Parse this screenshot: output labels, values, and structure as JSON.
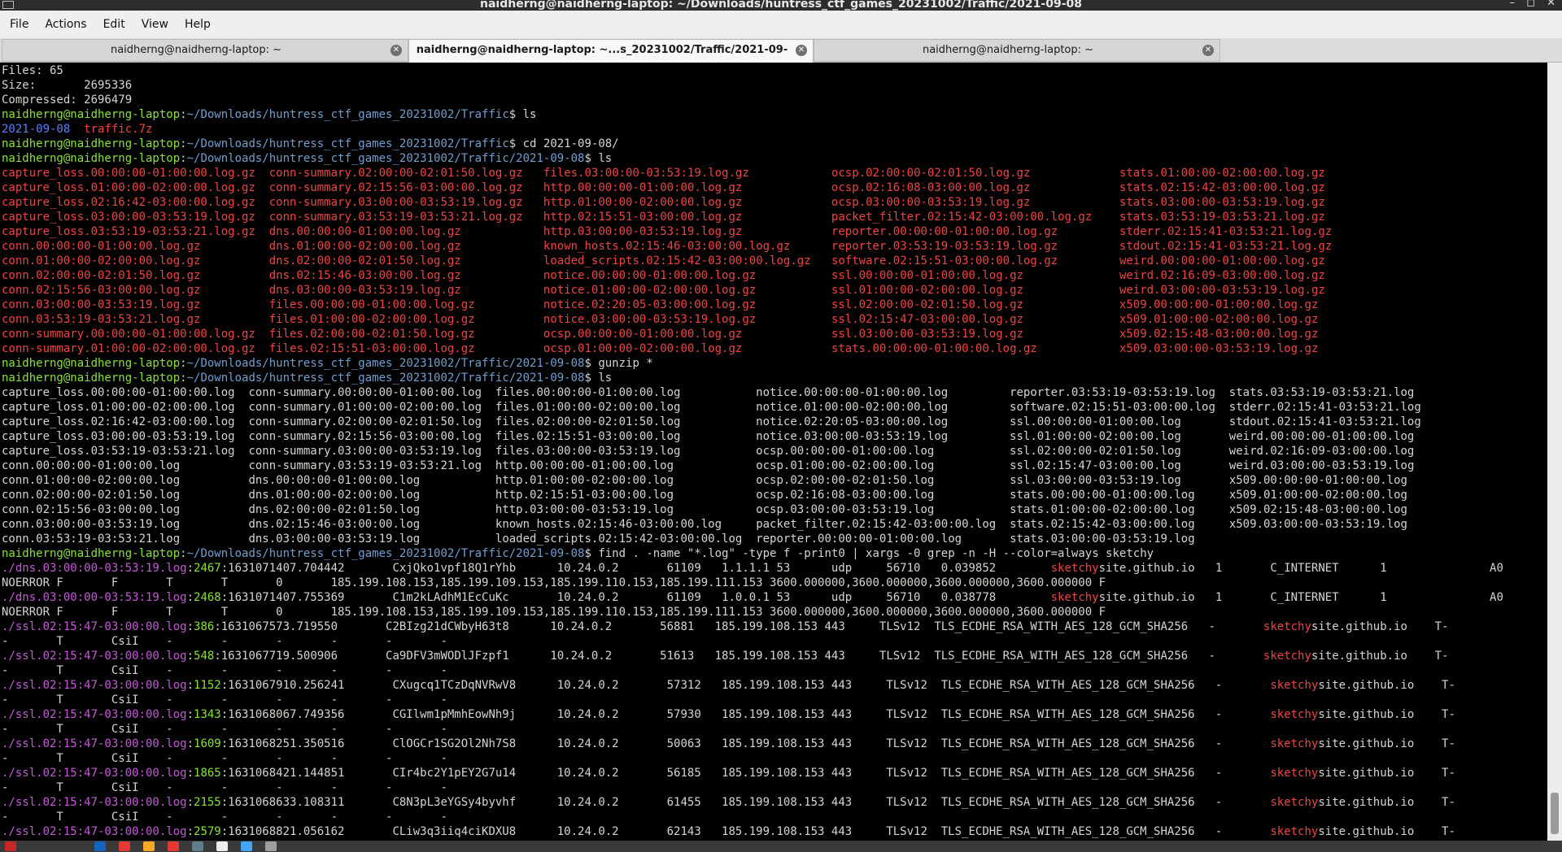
{
  "window": {
    "title": "naidherng@naidherng-laptop: ~/Downloads/huntress_ctf_games_20231002/Traffic/2021-09-08",
    "controls": [
      "minimize",
      "maximize",
      "close"
    ]
  },
  "menubar": {
    "items": [
      "File",
      "Actions",
      "Edit",
      "View",
      "Help"
    ]
  },
  "tabs": [
    {
      "label": "naidherng@naidherng-laptop: ~",
      "active": false
    },
    {
      "label": "naidherng@naidherng-laptop: ~...s_20231002/Traffic/2021-09-08",
      "active": true
    },
    {
      "label": "naidherng@naidherng-laptop: ~",
      "active": false
    }
  ],
  "prompt": {
    "user": "naidherng@naidherng-laptop",
    "path_traffic": "~/Downloads/huntress_ctf_games_20231002/Traffic",
    "path_day": "~/Downloads/huntress_ctf_games_20231002/Traffic/2021-09-08"
  },
  "terminal": {
    "archive_stats": [
      "Files: 65",
      "Size:       2695336",
      "Compressed: 2696479"
    ],
    "commands": [
      "ls",
      "cd 2021-09-08/",
      "ls",
      "gunzip *",
      "ls",
      "find . -name \"*.log\" -type f -print0 | xargs -0 grep -n -H --color=always sketchy"
    ],
    "ls_traffic": [
      {
        "text": "2021-09-08",
        "kind": "dir"
      },
      {
        "text": "traffic.7z",
        "kind": "archive"
      }
    ],
    "gz_listing": [
      [
        "capture_loss.00:00:00-01:00:00.log.gz",
        "conn-summary.02:00:00-02:01:50.log.gz",
        "files.03:00:00-03:53:19.log.gz",
        "ocsp.02:00:00-02:01:50.log.gz",
        "stats.01:00:00-02:00:00.log.gz"
      ],
      [
        "capture_loss.01:00:00-02:00:00.log.gz",
        "conn-summary.02:15:56-03:00:00.log.gz",
        "http.00:00:00-01:00:00.log.gz",
        "ocsp.02:16:08-03:00:00.log.gz",
        "stats.02:15:42-03:00:00.log.gz"
      ],
      [
        "capture_loss.02:16:42-03:00:00.log.gz",
        "conn-summary.03:00:00-03:53:19.log.gz",
        "http.01:00:00-02:00:00.log.gz",
        "ocsp.03:00:00-03:53:19.log.gz",
        "stats.03:00:00-03:53:19.log.gz"
      ],
      [
        "capture_loss.03:00:00-03:53:19.log.gz",
        "conn-summary.03:53:19-03:53:21.log.gz",
        "http.02:15:51-03:00:00.log.gz",
        "packet_filter.02:15:42-03:00:00.log.gz",
        "stats.03:53:19-03:53:21.log.gz"
      ],
      [
        "capture_loss.03:53:19-03:53:21.log.gz",
        "dns.00:00:00-01:00:00.log.gz",
        "http.03:00:00-03:53:19.log.gz",
        "reporter.00:00:00-01:00:00.log.gz",
        "stderr.02:15:41-03:53:21.log.gz"
      ],
      [
        "conn.00:00:00-01:00:00.log.gz",
        "dns.01:00:00-02:00:00.log.gz",
        "known_hosts.02:15:46-03:00:00.log.gz",
        "reporter.03:53:19-03:53:19.log.gz",
        "stdout.02:15:41-03:53:21.log.gz"
      ],
      [
        "conn.01:00:00-02:00:00.log.gz",
        "dns.02:00:00-02:01:50.log.gz",
        "loaded_scripts.02:15:42-03:00:00.log.gz",
        "software.02:15:51-03:00:00.log.gz",
        "weird.00:00:00-01:00:00.log.gz"
      ],
      [
        "conn.02:00:00-02:01:50.log.gz",
        "dns.02:15:46-03:00:00.log.gz",
        "notice.00:00:00-01:00:00.log.gz",
        "ssl.00:00:00-01:00:00.log.gz",
        "weird.02:16:09-03:00:00.log.gz"
      ],
      [
        "conn.02:15:56-03:00:00.log.gz",
        "dns.03:00:00-03:53:19.log.gz",
        "notice.01:00:00-02:00:00.log.gz",
        "ssl.01:00:00-02:00:00.log.gz",
        "weird.03:00:00-03:53:19.log.gz"
      ],
      [
        "conn.03:00:00-03:53:19.log.gz",
        "files.00:00:00-01:00:00.log.gz",
        "notice.02:20:05-03:00:00.log.gz",
        "ssl.02:00:00-02:01:50.log.gz",
        "x509.00:00:00-01:00:00.log.gz"
      ],
      [
        "conn.03:53:19-03:53:21.log.gz",
        "files.01:00:00-02:00:00.log.gz",
        "notice.03:00:00-03:53:19.log.gz",
        "ssl.02:15:47-03:00:00.log.gz",
        "x509.01:00:00-02:00:00.log.gz"
      ],
      [
        "conn-summary.00:00:00-01:00:00.log.gz",
        "files.02:00:00-02:01:50.log.gz",
        "ocsp.00:00:00-01:00:00.log.gz",
        "ssl.03:00:00-03:53:19.log.gz",
        "x509.02:15:48-03:00:00.log.gz"
      ],
      [
        "conn-summary.01:00:00-02:00:00.log.gz",
        "files.02:15:51-03:00:00.log.gz",
        "ocsp.01:00:00-02:00:00.log.gz",
        "stats.00:00:00-01:00:00.log.gz",
        "x509.03:00:00-03:53:19.log.gz"
      ]
    ],
    "log_listing": [
      [
        "capture_loss.00:00:00-01:00:00.log",
        "conn-summary.00:00:00-01:00:00.log",
        "files.00:00:00-01:00:00.log",
        "notice.00:00:00-01:00:00.log",
        "reporter.03:53:19-03:53:19.log",
        "stats.03:53:19-03:53:21.log"
      ],
      [
        "capture_loss.01:00:00-02:00:00.log",
        "conn-summary.01:00:00-02:00:00.log",
        "files.01:00:00-02:00:00.log",
        "notice.01:00:00-02:00:00.log",
        "software.02:15:51-03:00:00.log",
        "stderr.02:15:41-03:53:21.log"
      ],
      [
        "capture_loss.02:16:42-03:00:00.log",
        "conn-summary.02:00:00-02:01:50.log",
        "files.02:00:00-02:01:50.log",
        "notice.02:20:05-03:00:00.log",
        "ssl.00:00:00-01:00:00.log",
        "stdout.02:15:41-03:53:21.log"
      ],
      [
        "capture_loss.03:00:00-03:53:19.log",
        "conn-summary.02:15:56-03:00:00.log",
        "files.02:15:51-03:00:00.log",
        "notice.03:00:00-03:53:19.log",
        "ssl.01:00:00-02:00:00.log",
        "weird.00:00:00-01:00:00.log"
      ],
      [
        "capture_loss.03:53:19-03:53:21.log",
        "conn-summary.03:00:00-03:53:19.log",
        "files.03:00:00-03:53:19.log",
        "ocsp.00:00:00-01:00:00.log",
        "ssl.02:00:00-02:01:50.log",
        "weird.02:16:09-03:00:00.log"
      ],
      [
        "conn.00:00:00-01:00:00.log",
        "conn-summary.03:53:19-03:53:21.log",
        "http.00:00:00-01:00:00.log",
        "ocsp.01:00:00-02:00:00.log",
        "ssl.02:15:47-03:00:00.log",
        "weird.03:00:00-03:53:19.log"
      ],
      [
        "conn.01:00:00-02:00:00.log",
        "dns.00:00:00-01:00:00.log",
        "http.01:00:00-02:00:00.log",
        "ocsp.02:00:00-02:01:50.log",
        "ssl.03:00:00-03:53:19.log",
        "x509.00:00:00-01:00:00.log"
      ],
      [
        "conn.02:00:00-02:01:50.log",
        "dns.01:00:00-02:00:00.log",
        "http.02:15:51-03:00:00.log",
        "ocsp.02:16:08-03:00:00.log",
        "stats.00:00:00-01:00:00.log",
        "x509.01:00:00-02:00:00.log"
      ],
      [
        "conn.02:15:56-03:00:00.log",
        "dns.02:00:00-02:01:50.log",
        "http.03:00:00-03:53:19.log",
        "ocsp.03:00:00-03:53:19.log",
        "stats.01:00:00-02:00:00.log",
        "x509.02:15:48-03:00:00.log"
      ],
      [
        "conn.03:00:00-03:53:19.log",
        "dns.02:15:46-03:00:00.log",
        "known_hosts.02:15:46-03:00:00.log",
        "packet_filter.02:15:42-03:00:00.log",
        "stats.02:15:42-03:00:00.log",
        "x509.03:00:00-03:53:19.log"
      ],
      [
        "conn.03:53:19-03:53:21.log",
        "dns.03:00:00-03:53:19.log",
        "loaded_scripts.02:15:42-03:00:00.log",
        "reporter.00:00:00-01:00:00.log",
        "stats.03:00:00-03:53:19.log",
        ""
      ]
    ],
    "grep_match": "sketchy",
    "dns_hits": [
      {
        "file": "./dns.03:00:00-03:53:19.log",
        "line": "2467",
        "ts": "1631071407.704442",
        "uid": "CxjQko1vpf18Q1rYhb",
        "src": "10.24.0.2",
        "sport": "61109",
        "dst": "1.1.1.1",
        "dport": "53",
        "proto": "udp",
        "tid": "56710",
        "rtt": "0.039852",
        "rest": "site.github.io",
        "qc": "1",
        "qclass": "C_INTERNET",
        "qt": "1",
        "tail": "A",
        "cont": "NOERROR F       F       T       T       0       185.199.108.153,185.199.109.153,185.199.110.153,185.199.111.153 3600.000000,3600.000000,3600.000000,3600.000000 F"
      },
      {
        "file": "./dns.03:00:00-03:53:19.log",
        "line": "2468",
        "ts": "1631071407.755369",
        "uid": "C1m2kLAdhM1EcCuKc",
        "src": "10.24.0.2",
        "sport": "61109",
        "dst": "1.0.0.1",
        "dport": "53",
        "proto": "udp",
        "tid": "56710",
        "rtt": "0.038778",
        "rest": "site.github.io",
        "qc": "1",
        "qclass": "C_INTERNET",
        "qt": "1",
        "tail": "A",
        "cont": "NOERROR F       F       T       T       0       185.199.108.153,185.199.109.153,185.199.110.153,185.199.111.153 3600.000000,3600.000000,3600.000000,3600.000000 F"
      }
    ],
    "ssl_hits": [
      {
        "file": "./ssl.02:15:47-03:00:00.log",
        "line": "386",
        "ts": "1631067573.719550",
        "uid": "C2BIzg21dCWbyH63t8",
        "src": "10.24.0.2",
        "sport": "56881",
        "dst": "185.199.108.153",
        "dport": "443",
        "ver": "TLSv12",
        "cipher": "TLS_ECDHE_RSA_WITH_AES_128_GCM_SHA256",
        "dash": "-",
        "rest": "site.github.io",
        "tail": "T-",
        "cont": "-       T       CsiI    -       -       -       -       -       -"
      },
      {
        "file": "./ssl.02:15:47-03:00:00.log",
        "line": "548",
        "ts": "1631067719.500906",
        "uid": "Ca9DFV3mWODlJFzpf1",
        "src": "10.24.0.2",
        "sport": "51613",
        "dst": "185.199.108.153",
        "dport": "443",
        "ver": "TLSv12",
        "cipher": "TLS_ECDHE_RSA_WITH_AES_128_GCM_SHA256",
        "dash": "-",
        "rest": "site.github.io",
        "tail": "T-",
        "cont": "-       T       CsiI    -       -       -       -       -       -"
      },
      {
        "file": "./ssl.02:15:47-03:00:00.log",
        "line": "1152",
        "ts": "1631067910.256241",
        "uid": "CXugcq1TCzDqNVRwV8",
        "src": "10.24.0.2",
        "sport": "57312",
        "dst": "185.199.108.153",
        "dport": "443",
        "ver": "TLSv12",
        "cipher": "TLS_ECDHE_RSA_WITH_AES_128_GCM_SHA256",
        "dash": "-",
        "rest": "site.github.io",
        "tail": "T-",
        "cont": "-       T       CsiI    -       -       -       -       -       -"
      },
      {
        "file": "./ssl.02:15:47-03:00:00.log",
        "line": "1343",
        "ts": "1631068067.749356",
        "uid": "CGIlwm1pMmhEowNh9j",
        "src": "10.24.0.2",
        "sport": "57930",
        "dst": "185.199.108.153",
        "dport": "443",
        "ver": "TLSv12",
        "cipher": "TLS_ECDHE_RSA_WITH_AES_128_GCM_SHA256",
        "dash": "-",
        "rest": "site.github.io",
        "tail": "T-",
        "cont": "-       T       CsiI    -       -       -       -       -       -"
      },
      {
        "file": "./ssl.02:15:47-03:00:00.log",
        "line": "1609",
        "ts": "1631068251.350516",
        "uid": "ClOGCr1SG2Ol2Nh7S8",
        "src": "10.24.0.2",
        "sport": "50063",
        "dst": "185.199.108.153",
        "dport": "443",
        "ver": "TLSv12",
        "cipher": "TLS_ECDHE_RSA_WITH_AES_128_GCM_SHA256",
        "dash": "-",
        "rest": "site.github.io",
        "tail": "T-",
        "cont": "-       T       CsiI    -       -       -       -       -       -"
      },
      {
        "file": "./ssl.02:15:47-03:00:00.log",
        "line": "1865",
        "ts": "1631068421.144851",
        "uid": "CIr4bc2Y1pEY2G7u14",
        "src": "10.24.0.2",
        "sport": "56185",
        "dst": "185.199.108.153",
        "dport": "443",
        "ver": "TLSv12",
        "cipher": "TLS_ECDHE_RSA_WITH_AES_128_GCM_SHA256",
        "dash": "-",
        "rest": "site.github.io",
        "tail": "T-",
        "cont": "-       T       CsiI    -       -       -       -       -       -"
      },
      {
        "file": "./ssl.02:15:47-03:00:00.log",
        "line": "2155",
        "ts": "1631068633.108311",
        "uid": "C8N3pL3eYGSy4byvhf",
        "src": "10.24.0.2",
        "sport": "61455",
        "dst": "185.199.108.153",
        "dport": "443",
        "ver": "TLSv12",
        "cipher": "TLS_ECDHE_RSA_WITH_AES_128_GCM_SHA256",
        "dash": "-",
        "rest": "site.github.io",
        "tail": "T-",
        "cont": "-       T       CsiI    -       -       -       -       -       -"
      },
      {
        "file": "./ssl.02:15:47-03:00:00.log",
        "line": "2579",
        "ts": "1631068821.056162",
        "uid": "CLiw3q3iiq4ciKDXU8",
        "src": "10.24.0.2",
        "sport": "62143",
        "dst": "185.199.108.153",
        "dport": "443",
        "ver": "TLSv12",
        "cipher": "TLS_ECDHE_RSA_WITH_AES_128_GCM_SHA256",
        "dash": "-",
        "rest": "site.github.io",
        "tail": "T-",
        "cont": ""
      }
    ]
  },
  "scrollbar": {
    "thumb_start": 0.938,
    "thumb_end": 0.992
  },
  "taskbar": {
    "icon_colors": [
      "#c62828",
      "#1565c0",
      "#e53935",
      "#f9a825",
      "#e53935",
      "#607d8b",
      "#eeeeee",
      "#42a5f5",
      "#9e9e9e"
    ]
  },
  "colors": {
    "prompt_user": "#8ae234",
    "prompt_path": "#729fcf",
    "directory": "#5c7fff",
    "archive": "#ef4444",
    "grep_file": "#c45ad6",
    "grep_match": "#ef4444"
  }
}
